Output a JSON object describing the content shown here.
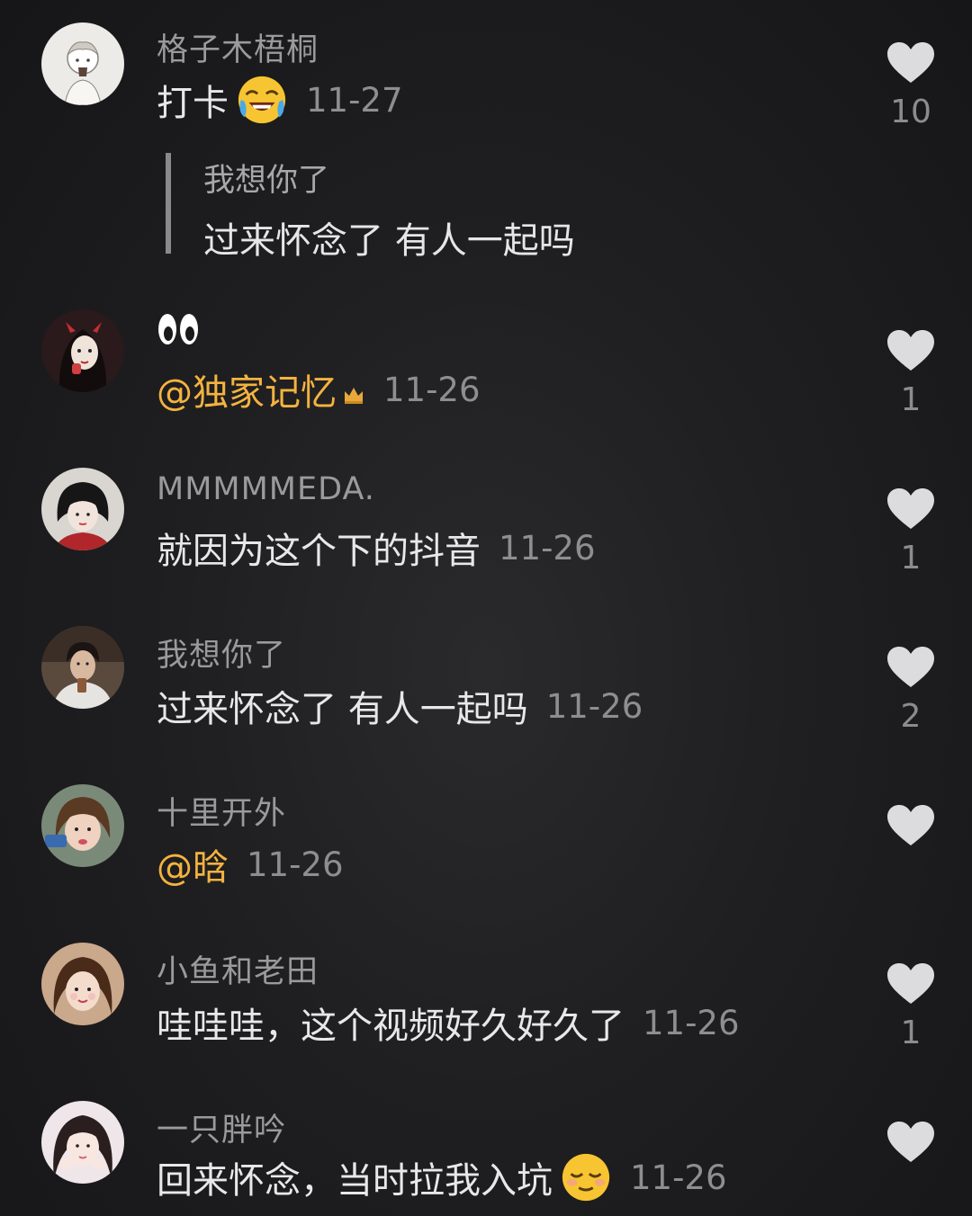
{
  "comments": [
    {
      "username": "格子木梧桐",
      "text": "打卡",
      "emoji": "laughing-crying-emoji",
      "date": "11-27",
      "likes": "10",
      "reply_quote": {
        "username": "我想你了",
        "text": "过来怀念了 有人一起吗"
      }
    },
    {
      "username": "",
      "emoji_only": "eyes-emoji",
      "mention": "@独家记忆",
      "badge": "crown-icon",
      "date": "11-26",
      "likes": "1"
    },
    {
      "username": "MMMMMEDA.",
      "text": "就因为这个下的抖音",
      "date": "11-26",
      "likes": "1"
    },
    {
      "username": "我想你了",
      "text": "过来怀念了 有人一起吗",
      "date": "11-26",
      "likes": "2"
    },
    {
      "username": "十里开外",
      "mention": "@晗",
      "date": "11-26",
      "likes": ""
    },
    {
      "username": "小鱼和老田",
      "text": "哇哇哇，这个视频好久好久了",
      "date": "11-26",
      "likes": "1"
    },
    {
      "username": "一只胖吟",
      "text": "回来怀念，当时拉我入坑",
      "emoji": "relieved-emoji",
      "date": "11-26",
      "likes": ""
    }
  ],
  "colors": {
    "background": "#1f1f21",
    "mention": "#f4b33f",
    "username": "#9a9a9c",
    "text": "#e8e8ea",
    "heart": "#dcdcde"
  }
}
